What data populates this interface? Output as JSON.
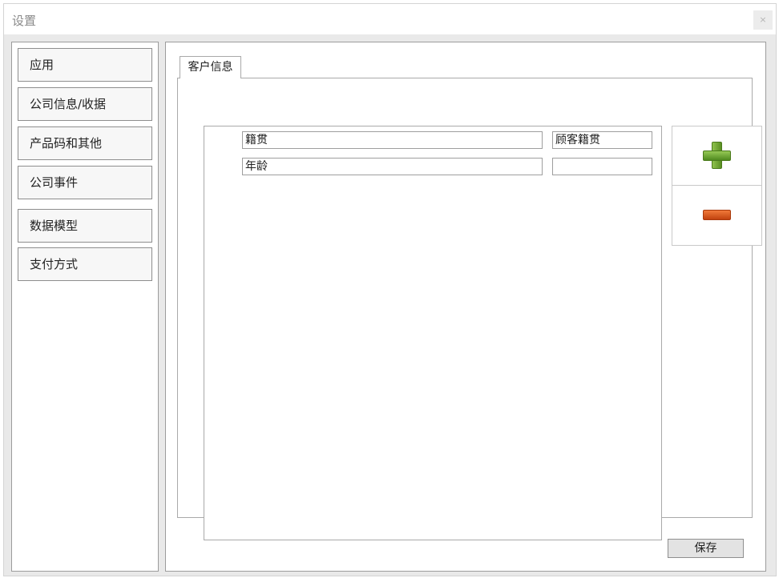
{
  "window": {
    "title": "设置",
    "close_glyph": "×"
  },
  "sidebar": {
    "items": [
      {
        "label": "应用"
      },
      {
        "label": "公司信息/收据"
      },
      {
        "label": "产品码和其他"
      },
      {
        "label": "公司事件"
      },
      {
        "label": "数据模型"
      },
      {
        "label": "支付方式"
      }
    ]
  },
  "tabs": [
    {
      "label": "客户信息"
    }
  ],
  "fields": [
    {
      "name": "籍贯",
      "label": "顾客籍贯"
    },
    {
      "name": "年龄",
      "label": ""
    }
  ],
  "buttons": {
    "add_icon": "plus-icon",
    "remove_icon": "minus-icon",
    "save_label": "保存"
  },
  "colors": {
    "add": "#6aa02e",
    "remove": "#e0561e"
  }
}
